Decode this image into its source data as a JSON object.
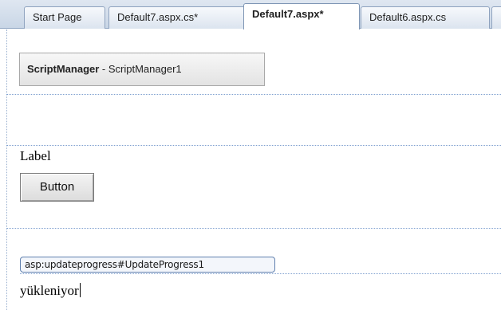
{
  "tabs": [
    {
      "label": "Start Page",
      "active": false
    },
    {
      "label": "Default7.aspx.cs*",
      "active": false
    },
    {
      "label": "Default7.aspx*",
      "active": true
    },
    {
      "label": "Default6.aspx.cs",
      "active": false
    }
  ],
  "design": {
    "script_manager": {
      "type": "ScriptManager",
      "separator": " - ",
      "id": "ScriptManager1"
    },
    "label_text": "Label",
    "button_text": "Button",
    "update_progress_tag": "asp:updateprogress#UpdateProgress1",
    "update_progress_text": "yükleniyor"
  }
}
